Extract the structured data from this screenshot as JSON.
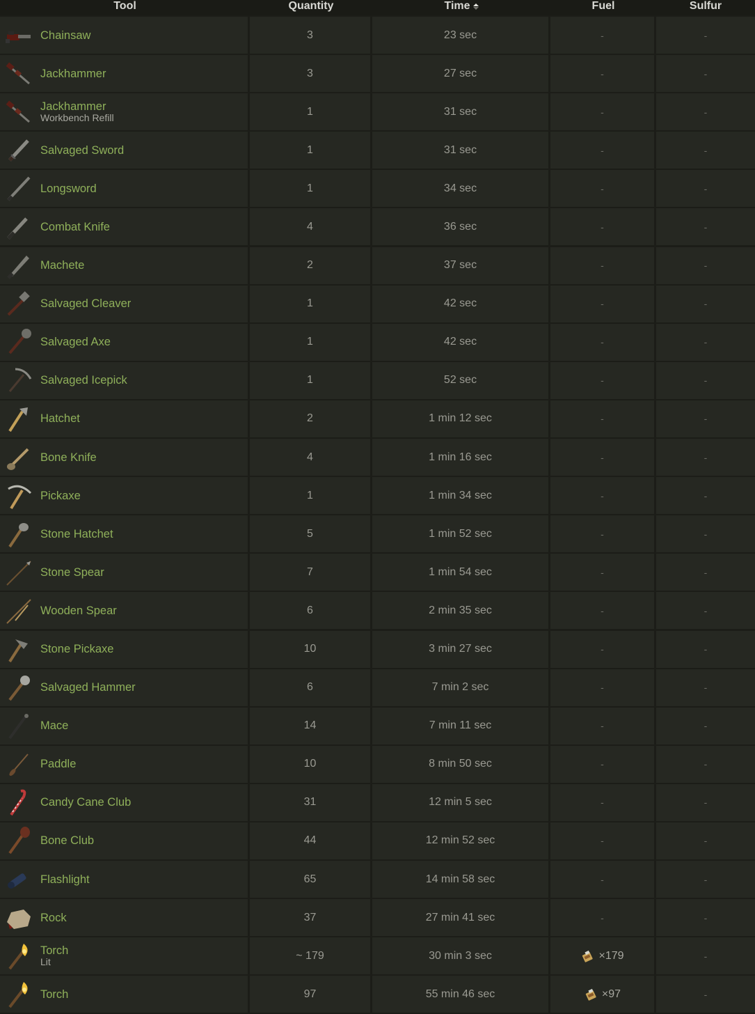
{
  "header": {
    "tool": "Tool",
    "quantity": "Quantity",
    "time": "Time",
    "fuel": "Fuel",
    "sulfur": "Sulfur"
  },
  "sort": {
    "column": "time",
    "direction": "ascending"
  },
  "rows": [
    {
      "name": "Chainsaw",
      "sub": "",
      "quantity": "3",
      "time": "23 sec",
      "fuel": "-",
      "sulfur": "-",
      "icon": "chainsaw-icon"
    },
    {
      "name": "Jackhammer",
      "sub": "",
      "quantity": "3",
      "time": "27 sec",
      "fuel": "-",
      "sulfur": "-",
      "icon": "jackhammer-icon"
    },
    {
      "name": "Jackhammer",
      "sub": "Workbench Refill",
      "quantity": "1",
      "time": "31 sec",
      "fuel": "-",
      "sulfur": "-",
      "icon": "jackhammer-icon"
    },
    {
      "name": "Salvaged Sword",
      "sub": "",
      "quantity": "1",
      "time": "31 sec",
      "fuel": "-",
      "sulfur": "-",
      "icon": "sword-icon"
    },
    {
      "name": "Longsword",
      "sub": "",
      "quantity": "1",
      "time": "34 sec",
      "fuel": "-",
      "sulfur": "-",
      "icon": "longsword-icon"
    },
    {
      "name": "Combat Knife",
      "sub": "",
      "quantity": "4",
      "time": "36 sec",
      "fuel": "-",
      "sulfur": "-",
      "icon": "knife-icon"
    },
    {
      "name": "Machete",
      "sub": "",
      "quantity": "2",
      "time": "37 sec",
      "fuel": "-",
      "sulfur": "-",
      "icon": "machete-icon"
    },
    {
      "name": "Salvaged Cleaver",
      "sub": "",
      "quantity": "1",
      "time": "42 sec",
      "fuel": "-",
      "sulfur": "-",
      "icon": "cleaver-icon"
    },
    {
      "name": "Salvaged Axe",
      "sub": "",
      "quantity": "1",
      "time": "42 sec",
      "fuel": "-",
      "sulfur": "-",
      "icon": "axe-icon"
    },
    {
      "name": "Salvaged Icepick",
      "sub": "",
      "quantity": "1",
      "time": "52 sec",
      "fuel": "-",
      "sulfur": "-",
      "icon": "icepick-icon"
    },
    {
      "name": "Hatchet",
      "sub": "",
      "quantity": "2",
      "time": "1 min 12 sec",
      "fuel": "-",
      "sulfur": "-",
      "icon": "hatchet-icon"
    },
    {
      "name": "Bone Knife",
      "sub": "",
      "quantity": "4",
      "time": "1 min 16 sec",
      "fuel": "-",
      "sulfur": "-",
      "icon": "bone-knife-icon"
    },
    {
      "name": "Pickaxe",
      "sub": "",
      "quantity": "1",
      "time": "1 min 34 sec",
      "fuel": "-",
      "sulfur": "-",
      "icon": "pickaxe-icon"
    },
    {
      "name": "Stone Hatchet",
      "sub": "",
      "quantity": "5",
      "time": "1 min 52 sec",
      "fuel": "-",
      "sulfur": "-",
      "icon": "stone-hatchet-icon"
    },
    {
      "name": "Stone Spear",
      "sub": "",
      "quantity": "7",
      "time": "1 min 54 sec",
      "fuel": "-",
      "sulfur": "-",
      "icon": "stone-spear-icon"
    },
    {
      "name": "Wooden Spear",
      "sub": "",
      "quantity": "6",
      "time": "2 min 35 sec",
      "fuel": "-",
      "sulfur": "-",
      "icon": "wooden-spear-icon"
    },
    {
      "name": "Stone Pickaxe",
      "sub": "",
      "quantity": "10",
      "time": "3 min 27 sec",
      "fuel": "-",
      "sulfur": "-",
      "icon": "stone-pickaxe-icon"
    },
    {
      "name": "Salvaged Hammer",
      "sub": "",
      "quantity": "6",
      "time": "7 min 2 sec",
      "fuel": "-",
      "sulfur": "-",
      "icon": "hammer-icon"
    },
    {
      "name": "Mace",
      "sub": "",
      "quantity": "14",
      "time": "7 min 11 sec",
      "fuel": "-",
      "sulfur": "-",
      "icon": "mace-icon"
    },
    {
      "name": "Paddle",
      "sub": "",
      "quantity": "10",
      "time": "8 min 50 sec",
      "fuel": "-",
      "sulfur": "-",
      "icon": "paddle-icon"
    },
    {
      "name": "Candy Cane Club",
      "sub": "",
      "quantity": "31",
      "time": "12 min 5 sec",
      "fuel": "-",
      "sulfur": "-",
      "icon": "candy-cane-icon"
    },
    {
      "name": "Bone Club",
      "sub": "",
      "quantity": "44",
      "time": "12 min 52 sec",
      "fuel": "-",
      "sulfur": "-",
      "icon": "bone-club-icon"
    },
    {
      "name": "Flashlight",
      "sub": "",
      "quantity": "65",
      "time": "14 min 58 sec",
      "fuel": "-",
      "sulfur": "-",
      "icon": "flashlight-icon"
    },
    {
      "name": "Rock",
      "sub": "",
      "quantity": "37",
      "time": "27 min 41 sec",
      "fuel": "-",
      "sulfur": "-",
      "icon": "rock-icon"
    },
    {
      "name": "Torch",
      "sub": "Lit",
      "quantity": "~ 179",
      "time": "30 min 3 sec",
      "fuel": "×179",
      "fuel_icon": "low-grade-fuel-icon",
      "sulfur": "-",
      "icon": "torch-icon"
    },
    {
      "name": "Torch",
      "sub": "",
      "quantity": "97",
      "time": "55 min 46 sec",
      "fuel": "×97",
      "fuel_icon": "low-grade-fuel-icon",
      "sulfur": "-",
      "icon": "torch-icon"
    }
  ],
  "colors": {
    "background": "#1c1d18",
    "cell": "#262822",
    "tool_name": "#8fb05a",
    "text": "#9a9a92",
    "header_text": "#d9d9d4"
  }
}
